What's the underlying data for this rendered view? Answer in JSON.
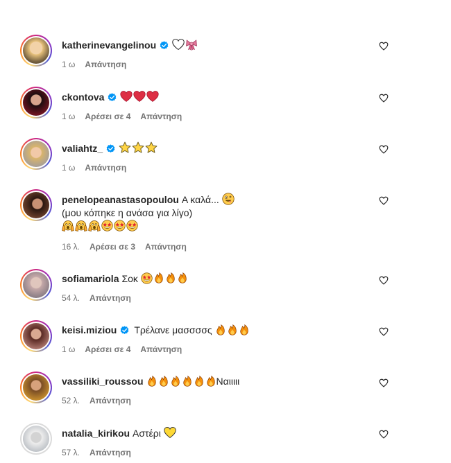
{
  "comments": [
    {
      "username": "katherinevangelinou",
      "verified": true,
      "text": "",
      "emoji": [
        "white-heart",
        "ribbon"
      ],
      "time": "1 ω",
      "likes": "",
      "reply": "Απάντηση"
    },
    {
      "username": "ckontova",
      "verified": true,
      "text": "",
      "emoji": [
        "red-heart",
        "red-heart",
        "red-heart"
      ],
      "time": "1 ω",
      "likes": "Αρέσει σε 4",
      "reply": "Απάντηση"
    },
    {
      "username": "valiahtz_",
      "verified": true,
      "text": "",
      "emoji": [
        "star",
        "star",
        "star"
      ],
      "time": "1 ω",
      "likes": "",
      "reply": "Απάντηση"
    },
    {
      "username": "penelopeanastasopoulou",
      "verified": false,
      "text": "Α καλά...",
      "emoji": [
        "zany-face"
      ],
      "text2": "(μου κόπηκε η ανάσα για λίγο)",
      "emoji_line3": [
        "screaming-face",
        "screaming-face",
        "screaming-face",
        "star-struck",
        "star-struck",
        "star-struck"
      ],
      "time": "16 λ.",
      "likes": "Αρέσει σε 3",
      "reply": "Απάντηση"
    },
    {
      "username": "sofiamariola",
      "verified": false,
      "text": "Σοκ",
      "emoji": [
        "star-struck",
        "fire",
        "fire",
        "fire"
      ],
      "time": "54 λ.",
      "likes": "",
      "reply": "Απάντηση"
    },
    {
      "username": "keisi.miziou",
      "verified": true,
      "text": "Τρέλανε μασσσσς",
      "emoji": [
        "fire",
        "fire",
        "fire"
      ],
      "time": "1 ω",
      "likes": "Αρέσει σε 4",
      "reply": "Απάντηση"
    },
    {
      "username": "vassiliki_roussou",
      "verified": false,
      "text": "",
      "emoji": [
        "fire",
        "fire",
        "fire",
        "fire",
        "fire",
        "fire"
      ],
      "text_after": "Ναιιιιι",
      "time": "52 λ.",
      "likes": "",
      "reply": "Απάντηση"
    },
    {
      "username": "natalia_kirikou",
      "verified": false,
      "text": "Αστέρι",
      "emoji": [
        "yellow-heart"
      ],
      "time": "57 λ.",
      "likes": "",
      "reply": "Απάντηση"
    }
  ],
  "colors": {
    "text": "#262626",
    "meta": "#737373",
    "verified": "#0095f6",
    "heart": "#e0245e",
    "fire": "#f4900c"
  }
}
